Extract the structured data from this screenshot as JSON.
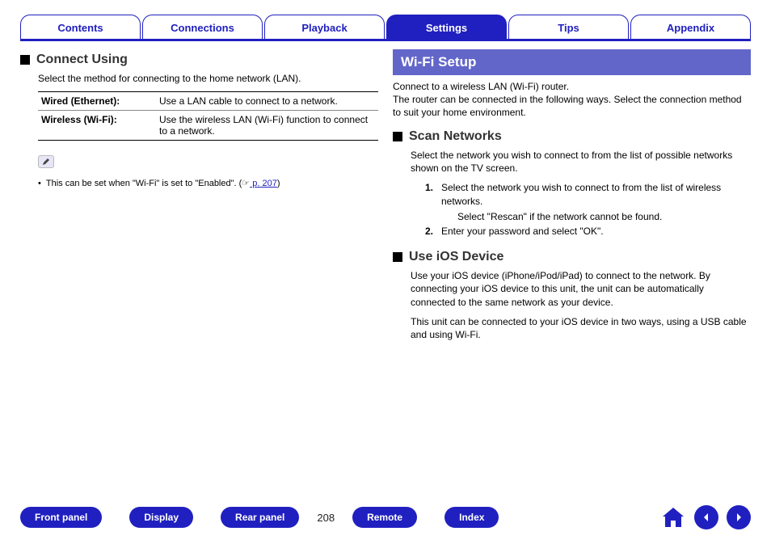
{
  "tabs": {
    "contents": "Contents",
    "connections": "Connections",
    "playback": "Playback",
    "settings": "Settings",
    "tips": "Tips",
    "appendix": "Appendix",
    "active": "settings"
  },
  "left": {
    "heading": "Connect Using",
    "intro": "Select the method for connecting to the home network (LAN).",
    "rows": [
      {
        "k": "Wired (Ethernet):",
        "v": "Use a LAN cable to connect to a network."
      },
      {
        "k": "Wireless (Wi-Fi):",
        "v": "Use the wireless LAN (Wi-Fi) function to connect to a network."
      }
    ],
    "note_bullet_pre": "This can be set when \"Wi-Fi\" is set to \"Enabled\". (",
    "note_link_icon": "☞",
    "note_link": " p. 207",
    "note_bullet_post": ")"
  },
  "right": {
    "banner": "Wi-Fi Setup",
    "intro1": "Connect to a wireless LAN (Wi-Fi) router.",
    "intro2": "The router can be connected in the following ways. Select the connection method to suit your home environment.",
    "scan": {
      "heading": "Scan Networks",
      "desc": "Select the network you wish to connect to from the list of possible networks shown on the TV screen.",
      "steps": [
        {
          "n": "1.",
          "t": "Select the network you wish to connect to from the list of wireless networks.",
          "sub": "Select \"Rescan\" if the network cannot be found."
        },
        {
          "n": "2.",
          "t": "Enter your password and select \"OK\"."
        }
      ]
    },
    "ios": {
      "heading": "Use iOS Device",
      "p1": "Use your iOS device (iPhone/iPod/iPad) to connect to the network. By connecting your iOS device to this unit, the unit can be automatically connected to the same network as your device.",
      "p2": "This unit can be connected to your iOS device in two ways, using a USB cable and using Wi-Fi."
    }
  },
  "footer": {
    "front_panel": "Front panel",
    "display": "Display",
    "rear_panel": "Rear panel",
    "page": "208",
    "remote": "Remote",
    "index": "Index"
  }
}
